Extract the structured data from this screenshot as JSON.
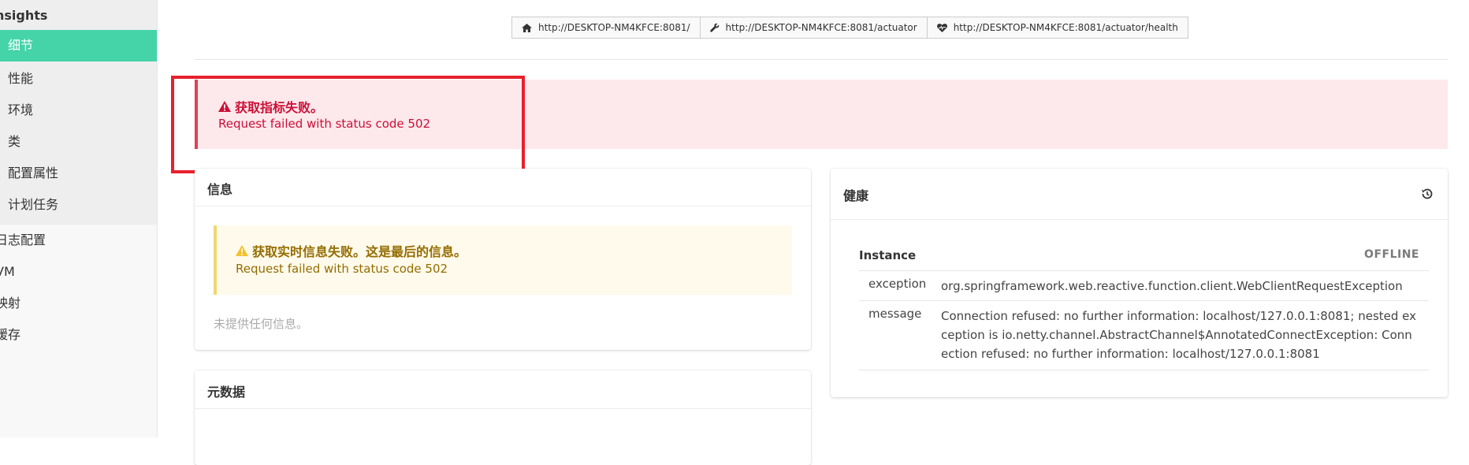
{
  "sidebar": {
    "title": "nsights",
    "items": [
      {
        "label": "细节",
        "active": true
      },
      {
        "label": "性能",
        "active": false
      },
      {
        "label": "环境",
        "active": false
      },
      {
        "label": "类",
        "active": false
      },
      {
        "label": "配置属性",
        "active": false
      },
      {
        "label": "计划任务",
        "active": false
      }
    ],
    "top_items": [
      {
        "label": "日志配置"
      },
      {
        "label": "VM"
      },
      {
        "label": "映射"
      },
      {
        "label": "缓存"
      }
    ]
  },
  "topbar": {
    "links": [
      {
        "icon": "home-icon",
        "url": "http://DESKTOP-NM4KFCE:8081/"
      },
      {
        "icon": "wrench-icon",
        "url": "http://DESKTOP-NM4KFCE:8081/actuator"
      },
      {
        "icon": "heartbeat-icon",
        "url": "http://DESKTOP-NM4KFCE:8081/actuator/health"
      }
    ]
  },
  "alert": {
    "title": "获取指标失败。",
    "message": "Request failed with status code 502"
  },
  "info_card": {
    "title": "信息",
    "warning_title": "获取实时信息失败。这是最后的信息。",
    "warning_message": "Request failed with status code 502",
    "empty_text": "未提供任何信息。"
  },
  "metadata_card": {
    "title": "元数据"
  },
  "health_card": {
    "title": "健康",
    "history_icon": "history-icon",
    "instance_label": "Instance",
    "status": "OFFLINE",
    "rows": [
      {
        "key": "exception",
        "value": "org.springframework.web.reactive.function.client.WebClientRequestException"
      },
      {
        "key": "message",
        "value": "Connection refused: no further information: localhost/127.0.0.1:8081; nested exception is io.netty.channel.AbstractChannel$AnnotatedConnectException: Connection refused: no further information: localhost/127.0.0.1:8081"
      }
    ]
  },
  "colors": {
    "accent": "#45d4a8",
    "danger": "#cc0f35",
    "warning": "#946c00",
    "highlight_box": "#e8202c"
  }
}
